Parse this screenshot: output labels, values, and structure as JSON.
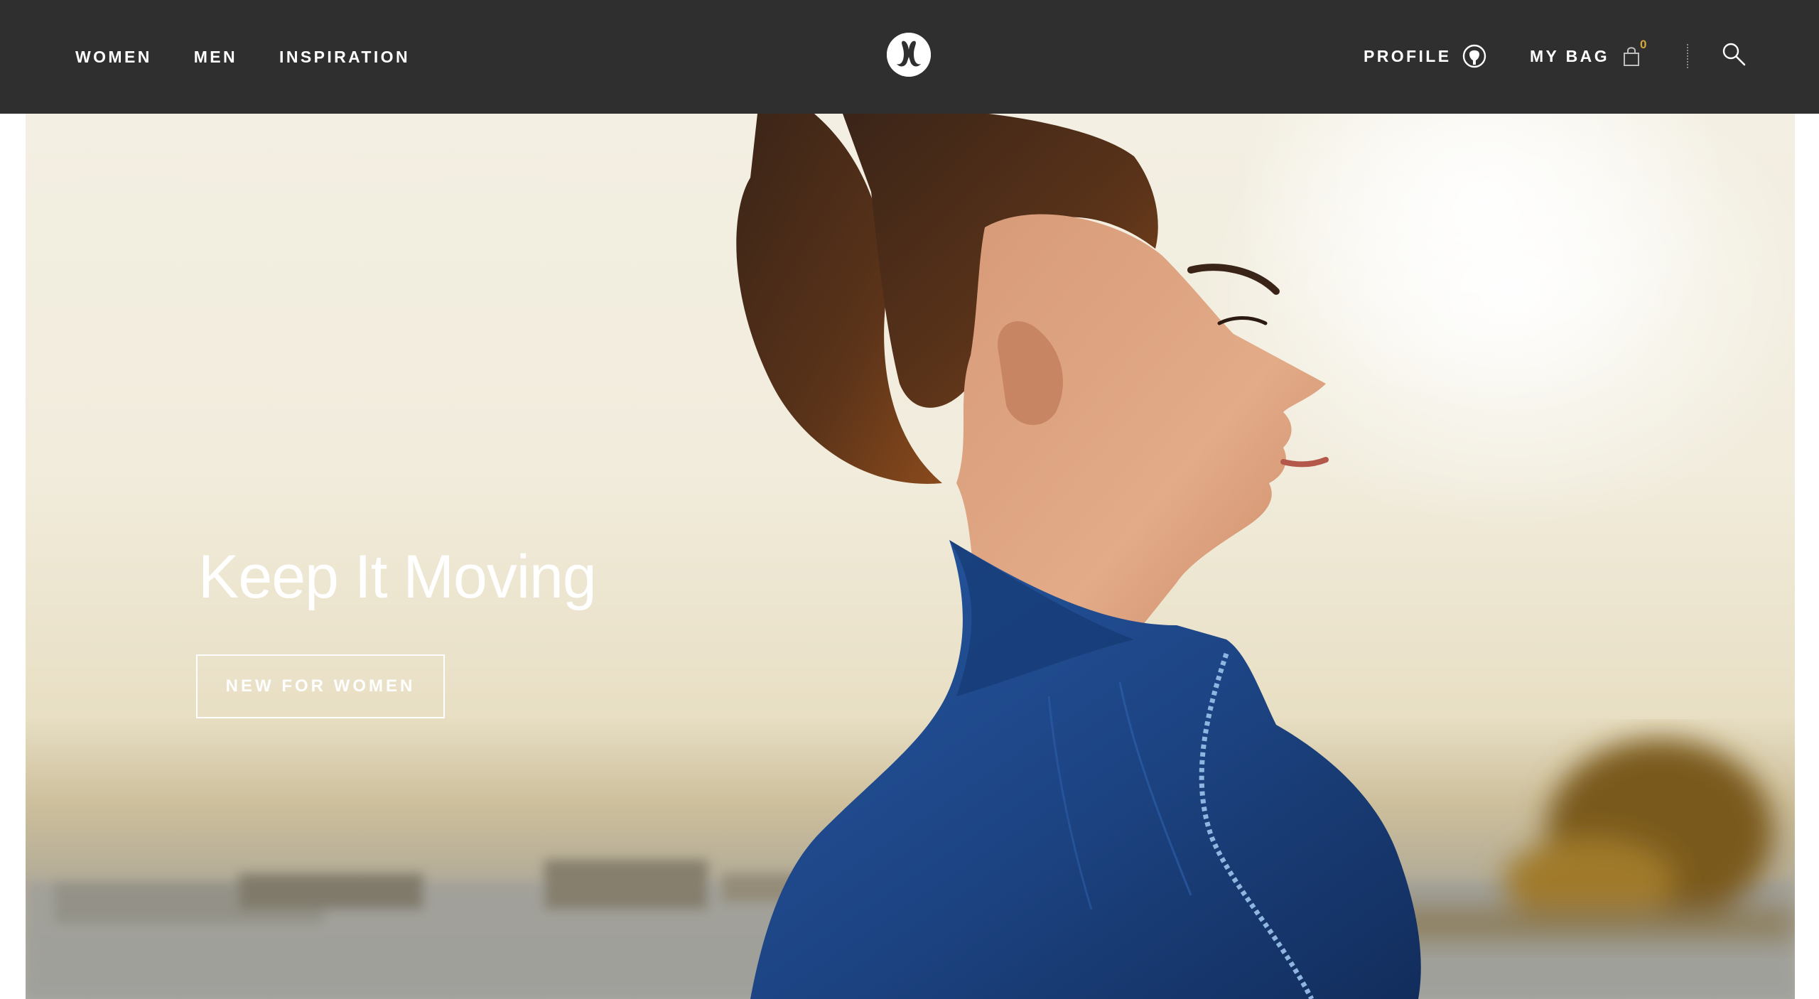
{
  "header": {
    "nav": [
      {
        "label": "WOMEN"
      },
      {
        "label": "MEN"
      },
      {
        "label": "INSPIRATION"
      }
    ],
    "profile_label": "PROFILE",
    "bag_label": "MY BAG",
    "bag_count": "0",
    "icons": {
      "logo": "lululemon-logo-icon",
      "profile": "user-circle-icon",
      "bag": "shopping-bag-icon",
      "search": "search-icon"
    }
  },
  "hero": {
    "title": "Keep It Moving",
    "cta_label": "NEW FOR WOMEN"
  },
  "colors": {
    "header_bg": "#2f2f2f",
    "text_light": "#ffffff",
    "bag_count": "#d6a83a",
    "jacket_blue": "#1f4a8c"
  }
}
